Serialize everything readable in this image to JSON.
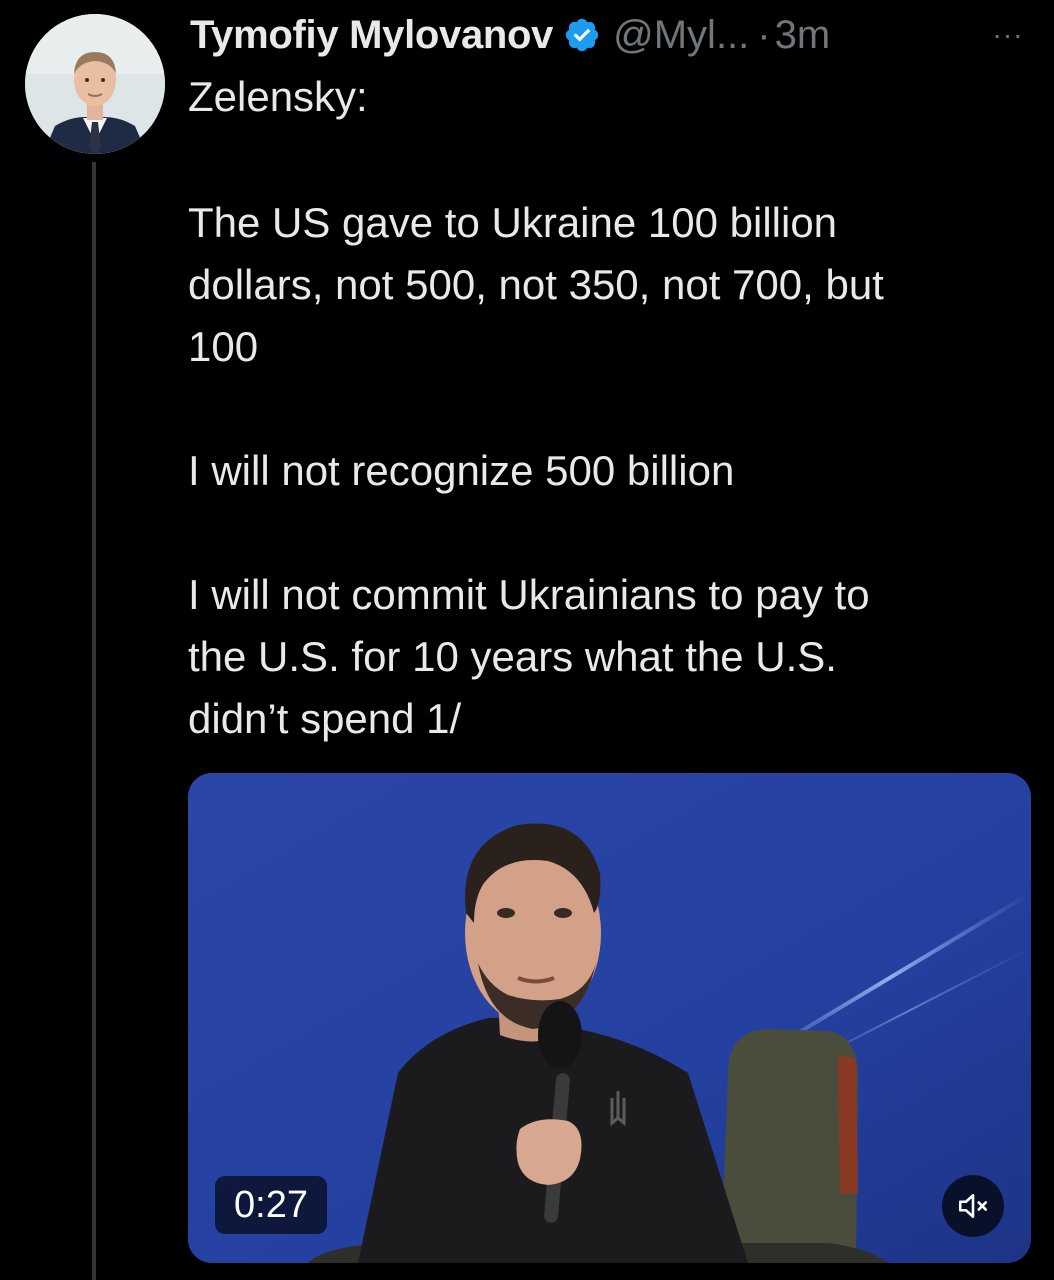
{
  "author": {
    "name": "Tymofiy Mylovanov",
    "handle": "@Myl...",
    "separator": "·",
    "time": "3m",
    "more_label": "···"
  },
  "tweet": {
    "lines": [
      "Zelensky:",
      "",
      "The US gave to Ukraine 100 billion",
      "dollars, not 500, not 350, not 700, but",
      "100",
      "",
      "I will not recognize 500 billion",
      "",
      "I will not commit Ukrainians to pay to",
      "the U.S. for 10 years what the U.S.",
      "didn’t spend 1/"
    ]
  },
  "video": {
    "duration": "0:27"
  },
  "icons": {
    "verified": "verified-badge-icon",
    "more": "more-dots-icon",
    "mute": "speaker-muted-icon"
  },
  "colors": {
    "background": "#000000",
    "text": "#e7e9ea",
    "secondary": "#71767b",
    "verified": "#1d9bf0",
    "thread_line": "#333639"
  }
}
